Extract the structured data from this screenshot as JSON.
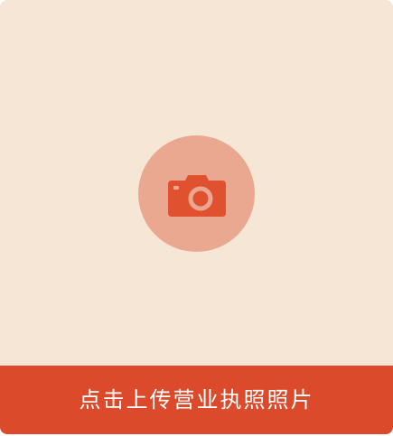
{
  "upload": {
    "icon": "camera-icon",
    "button_label": "点击上传营业执照照片"
  },
  "colors": {
    "card_background": "#f5e6d6",
    "circle_background": "#eaa891",
    "icon_color": "#e0512f",
    "bar_background": "#db4a2b",
    "bar_text": "#ffffff"
  }
}
